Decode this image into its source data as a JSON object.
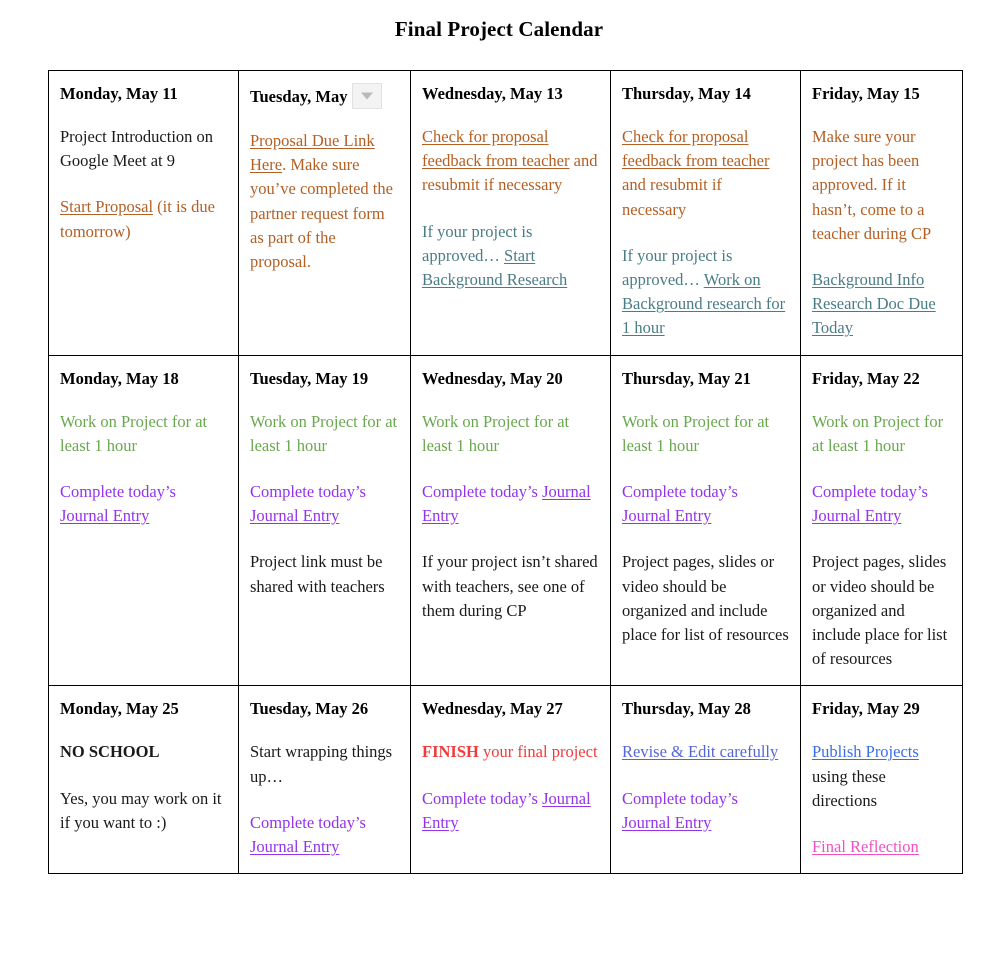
{
  "title": "Final Project Calendar",
  "colors": {
    "black": "#1a1a1a",
    "orange": "#b45f23",
    "slate": "#4a7c86",
    "green": "#6aa84f",
    "purple": "#9333ea",
    "red": "#ef3b3b",
    "blue": "#5566d6",
    "royal_blue": "#3a6ee8",
    "magenta": "#f24fc4",
    "border": "#000000",
    "dropdown_bg": "#f3f3f3",
    "dropdown_caret": "#b9b9b9"
  },
  "dropdown": {
    "icon": "chevron-down-icon",
    "state": "collapsed"
  },
  "calendar": {
    "weeks": [
      {
        "days": [
          {
            "header": "Monday, May 11",
            "paragraphs": [
              {
                "runs": [
                  {
                    "text": "Project Introduction on Google Meet at 9",
                    "color": "black",
                    "link": false,
                    "bold": false
                  }
                ]
              },
              {
                "runs": [
                  {
                    "text": "Start Proposal",
                    "color": "orange",
                    "link": true,
                    "bold": false
                  },
                  {
                    "text": " (it is due tomorrow)",
                    "color": "orange",
                    "link": false,
                    "bold": false
                  }
                ]
              }
            ]
          },
          {
            "header": "Tuesday, May",
            "has_dropdown": true,
            "paragraphs": [
              {
                "runs": [
                  {
                    "text": "Proposal Due Link Here",
                    "color": "orange",
                    "link": true,
                    "bold": false
                  },
                  {
                    "text": ". Make sure you’ve completed the partner request form as part of the proposal.",
                    "color": "orange",
                    "link": false,
                    "bold": false
                  }
                ]
              }
            ]
          },
          {
            "header": "Wednesday, May 13",
            "paragraphs": [
              {
                "runs": [
                  {
                    "text": "Check for proposal feedback from teacher",
                    "color": "orange",
                    "link": true,
                    "bold": false
                  },
                  {
                    "text": " and resubmit if necessary",
                    "color": "orange",
                    "link": false,
                    "bold": false
                  }
                ]
              },
              {
                "runs": [
                  {
                    "text": "If your project is approved… ",
                    "color": "slate",
                    "link": false,
                    "bold": false
                  },
                  {
                    "text": "Start Background Research",
                    "color": "slate",
                    "link": true,
                    "bold": false
                  }
                ]
              }
            ]
          },
          {
            "header": "Thursday, May 14",
            "paragraphs": [
              {
                "runs": [
                  {
                    "text": "Check for proposal feedback from teacher",
                    "color": "orange",
                    "link": true,
                    "bold": false
                  },
                  {
                    "text": " and resubmit if necessary",
                    "color": "orange",
                    "link": false,
                    "bold": false
                  }
                ]
              },
              {
                "runs": [
                  {
                    "text": "If your project is approved… ",
                    "color": "slate",
                    "link": false,
                    "bold": false
                  },
                  {
                    "text": "Work on Background research for 1 hour",
                    "color": "slate",
                    "link": true,
                    "bold": false
                  }
                ]
              }
            ]
          },
          {
            "header": "Friday, May 15",
            "paragraphs": [
              {
                "runs": [
                  {
                    "text": "Make sure your project has been approved. If it hasn’t, come to a teacher during CP",
                    "color": "orange",
                    "link": false,
                    "bold": false
                  }
                ]
              },
              {
                "runs": [
                  {
                    "text": "Background Info Research Doc Due Today",
                    "color": "slate",
                    "link": true,
                    "bold": false
                  }
                ]
              }
            ]
          }
        ]
      },
      {
        "days": [
          {
            "header": "Monday, May 18",
            "paragraphs": [
              {
                "runs": [
                  {
                    "text": "Work on Project for at least 1 hour",
                    "color": "green",
                    "link": false,
                    "bold": false
                  }
                ]
              },
              {
                "runs": [
                  {
                    "text": "Complete today’s ",
                    "color": "purple",
                    "link": false,
                    "bold": false
                  },
                  {
                    "text": "Journal Entry",
                    "color": "purple",
                    "link": true,
                    "bold": false
                  }
                ]
              }
            ]
          },
          {
            "header": "Tuesday, May 19",
            "paragraphs": [
              {
                "runs": [
                  {
                    "text": "Work on Project for at least 1 hour",
                    "color": "green",
                    "link": false,
                    "bold": false
                  }
                ]
              },
              {
                "runs": [
                  {
                    "text": "Complete today’s ",
                    "color": "purple",
                    "link": false,
                    "bold": false
                  },
                  {
                    "text": "Journal Entry",
                    "color": "purple",
                    "link": true,
                    "bold": false
                  }
                ]
              },
              {
                "runs": [
                  {
                    "text": "Project link must be shared with teachers",
                    "color": "black",
                    "link": false,
                    "bold": false
                  }
                ]
              }
            ]
          },
          {
            "header": "Wednesday, May 20",
            "paragraphs": [
              {
                "runs": [
                  {
                    "text": "Work on Project for at least 1 hour",
                    "color": "green",
                    "link": false,
                    "bold": false
                  }
                ]
              },
              {
                "runs": [
                  {
                    "text": "Complete today’s ",
                    "color": "purple",
                    "link": false,
                    "bold": false
                  },
                  {
                    "text": "Journal Entry",
                    "color": "purple",
                    "link": true,
                    "bold": false
                  }
                ]
              },
              {
                "runs": [
                  {
                    "text": "If your project isn’t shared with teachers, see one of them during CP",
                    "color": "black",
                    "link": false,
                    "bold": false
                  }
                ]
              }
            ]
          },
          {
            "header": "Thursday, May 21",
            "paragraphs": [
              {
                "runs": [
                  {
                    "text": "Work on Project for at least 1 hour",
                    "color": "green",
                    "link": false,
                    "bold": false
                  }
                ]
              },
              {
                "runs": [
                  {
                    "text": "Complete today’s ",
                    "color": "purple",
                    "link": false,
                    "bold": false
                  },
                  {
                    "text": "Journal Entry",
                    "color": "purple",
                    "link": true,
                    "bold": false
                  }
                ]
              },
              {
                "runs": [
                  {
                    "text": "Project pages, slides or video should be organized and include place for list of resources",
                    "color": "black",
                    "link": false,
                    "bold": false
                  }
                ]
              }
            ]
          },
          {
            "header": "Friday, May 22",
            "paragraphs": [
              {
                "runs": [
                  {
                    "text": "Work on Project for at least 1 hour",
                    "color": "green",
                    "link": false,
                    "bold": false
                  }
                ]
              },
              {
                "runs": [
                  {
                    "text": "Complete today’s ",
                    "color": "purple",
                    "link": false,
                    "bold": false
                  },
                  {
                    "text": "Journal Entry",
                    "color": "purple",
                    "link": true,
                    "bold": false
                  }
                ]
              },
              {
                "runs": [
                  {
                    "text": "Project pages, slides or video should be organized and include place for list of resources",
                    "color": "black",
                    "link": false,
                    "bold": false
                  }
                ]
              }
            ]
          }
        ]
      },
      {
        "days": [
          {
            "header": "Monday, May 25",
            "paragraphs": [
              {
                "runs": [
                  {
                    "text": "NO SCHOOL",
                    "color": "black",
                    "link": false,
                    "bold": true
                  }
                ]
              },
              {
                "runs": [
                  {
                    "text": "Yes, you may work on it if you want to :)",
                    "color": "black",
                    "link": false,
                    "bold": false
                  }
                ]
              }
            ]
          },
          {
            "header": "Tuesday, May 26",
            "paragraphs": [
              {
                "runs": [
                  {
                    "text": "Start wrapping things up…",
                    "color": "black",
                    "link": false,
                    "bold": false
                  }
                ]
              },
              {
                "runs": [
                  {
                    "text": "Complete today’s ",
                    "color": "purple",
                    "link": false,
                    "bold": false
                  },
                  {
                    "text": "Journal Entry",
                    "color": "purple",
                    "link": true,
                    "bold": false
                  }
                ]
              }
            ]
          },
          {
            "header": "Wednesday, May 27",
            "paragraphs": [
              {
                "runs": [
                  {
                    "text": "FINISH",
                    "color": "red",
                    "link": false,
                    "bold": true
                  },
                  {
                    "text": " your final project",
                    "color": "red",
                    "link": false,
                    "bold": false
                  }
                ]
              },
              {
                "runs": [
                  {
                    "text": "Complete today’s ",
                    "color": "purple",
                    "link": false,
                    "bold": false
                  },
                  {
                    "text": "Journal Entry",
                    "color": "purple",
                    "link": true,
                    "bold": false
                  }
                ]
              }
            ]
          },
          {
            "header": "Thursday, May 28",
            "paragraphs": [
              {
                "runs": [
                  {
                    "text": "Revise & Edit carefully",
                    "color": "blue",
                    "link": true,
                    "bold": false
                  }
                ]
              },
              {
                "runs": [
                  {
                    "text": "Complete today’s ",
                    "color": "purple",
                    "link": false,
                    "bold": false
                  },
                  {
                    "text": "Journal Entry",
                    "color": "purple",
                    "link": true,
                    "bold": false
                  }
                ]
              }
            ]
          },
          {
            "header": "Friday, May 29",
            "paragraphs": [
              {
                "runs": [
                  {
                    "text": "Publish Projects",
                    "color": "royal_blue",
                    "link": true,
                    "bold": false
                  },
                  {
                    "text": " using these directions",
                    "color": "black",
                    "link": false,
                    "bold": false
                  }
                ]
              },
              {
                "runs": [
                  {
                    "text": "Final Reflection",
                    "color": "magenta",
                    "link": true,
                    "bold": false
                  }
                ]
              }
            ]
          }
        ]
      }
    ]
  }
}
